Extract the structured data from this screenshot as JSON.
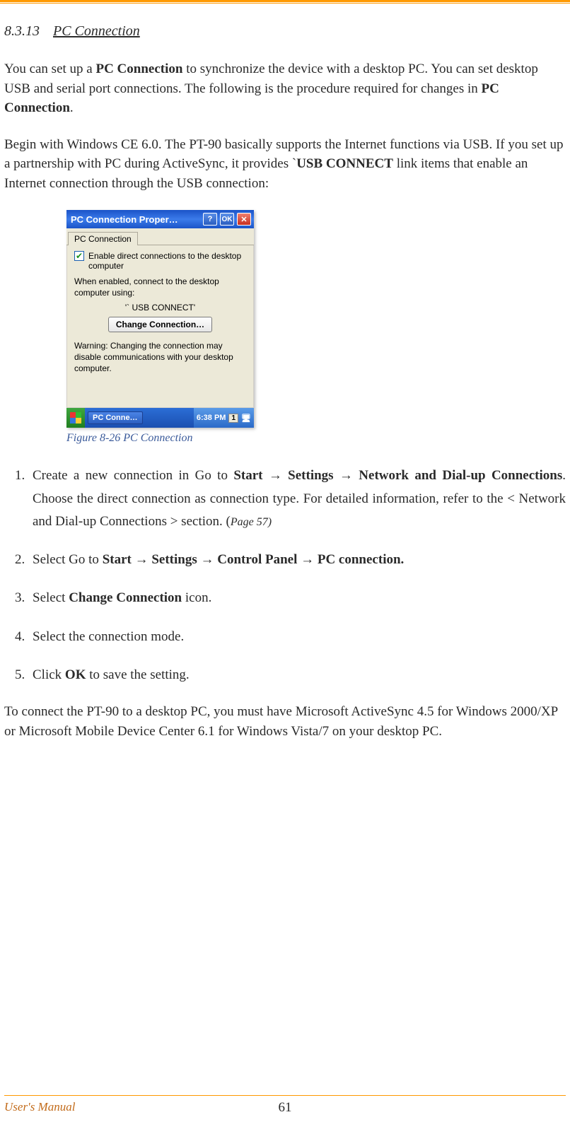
{
  "section": {
    "number": "8.3.13",
    "title": "PC Connection"
  },
  "para1a": "You can set up a ",
  "para1b": "PC Connection",
  "para1c": " to synchronize the device with a desktop PC. You can set desktop USB and serial port connections. The following is the procedure required for changes in ",
  "para1d": "PC Connection",
  "para1e": ".",
  "para2a": "Begin with Windows CE 6.0. The PT-90 basically supports the Internet functions via USB. If you set up a partnership with PC during ActiveSync, it provides `",
  "para2b": "USB CONNECT",
  "para2c": " link items that enable an Internet connection through the USB connection:",
  "dialog": {
    "title": "PC Connection Proper…",
    "help": "?",
    "ok": "OK",
    "close": "✕",
    "tab": "PC Connection",
    "checkbox_check": "✔",
    "checkbox_label": "Enable direct connections to the desktop computer",
    "when_enabled": "When enabled, connect to the desktop computer using:",
    "connect_name": "'` USB CONNECT'",
    "change_btn": "Change Connection…",
    "warning": "Warning: Changing the connection may disable communications with your desktop computer.",
    "task_label": "PC Conne…",
    "time": "6:38 PM",
    "tray_num": "1"
  },
  "caption": "Figure 8-26 PC Connection",
  "step1a": "Create a new connection in Go to ",
  "step1b": "Start → Settings → Network and Dial-up Connections",
  "step1c": ". Choose the direct connection as connection type. For detailed information, refer to the < Network and Dial-up Connections > section. (",
  "step1d": "Page 57)",
  "step2a": "Select Go to ",
  "step2b": "Start → Settings → Control Panel → PC connection.",
  "step3a": "Select ",
  "step3b": "Change Connection",
  "step3c": " icon.",
  "step4": "Select the connection mode.",
  "step5a": "Click ",
  "step5b": "OK",
  "step5c": " to save the setting.",
  "closing": "To connect the PT-90 to a desktop PC, you must have Microsoft ActiveSync 4.5 for Windows 2000/XP or Microsoft Mobile Device Center 6.1 for Windows Vista/7 on your desktop PC.",
  "footer": {
    "label": "User's Manual",
    "page": "61"
  }
}
